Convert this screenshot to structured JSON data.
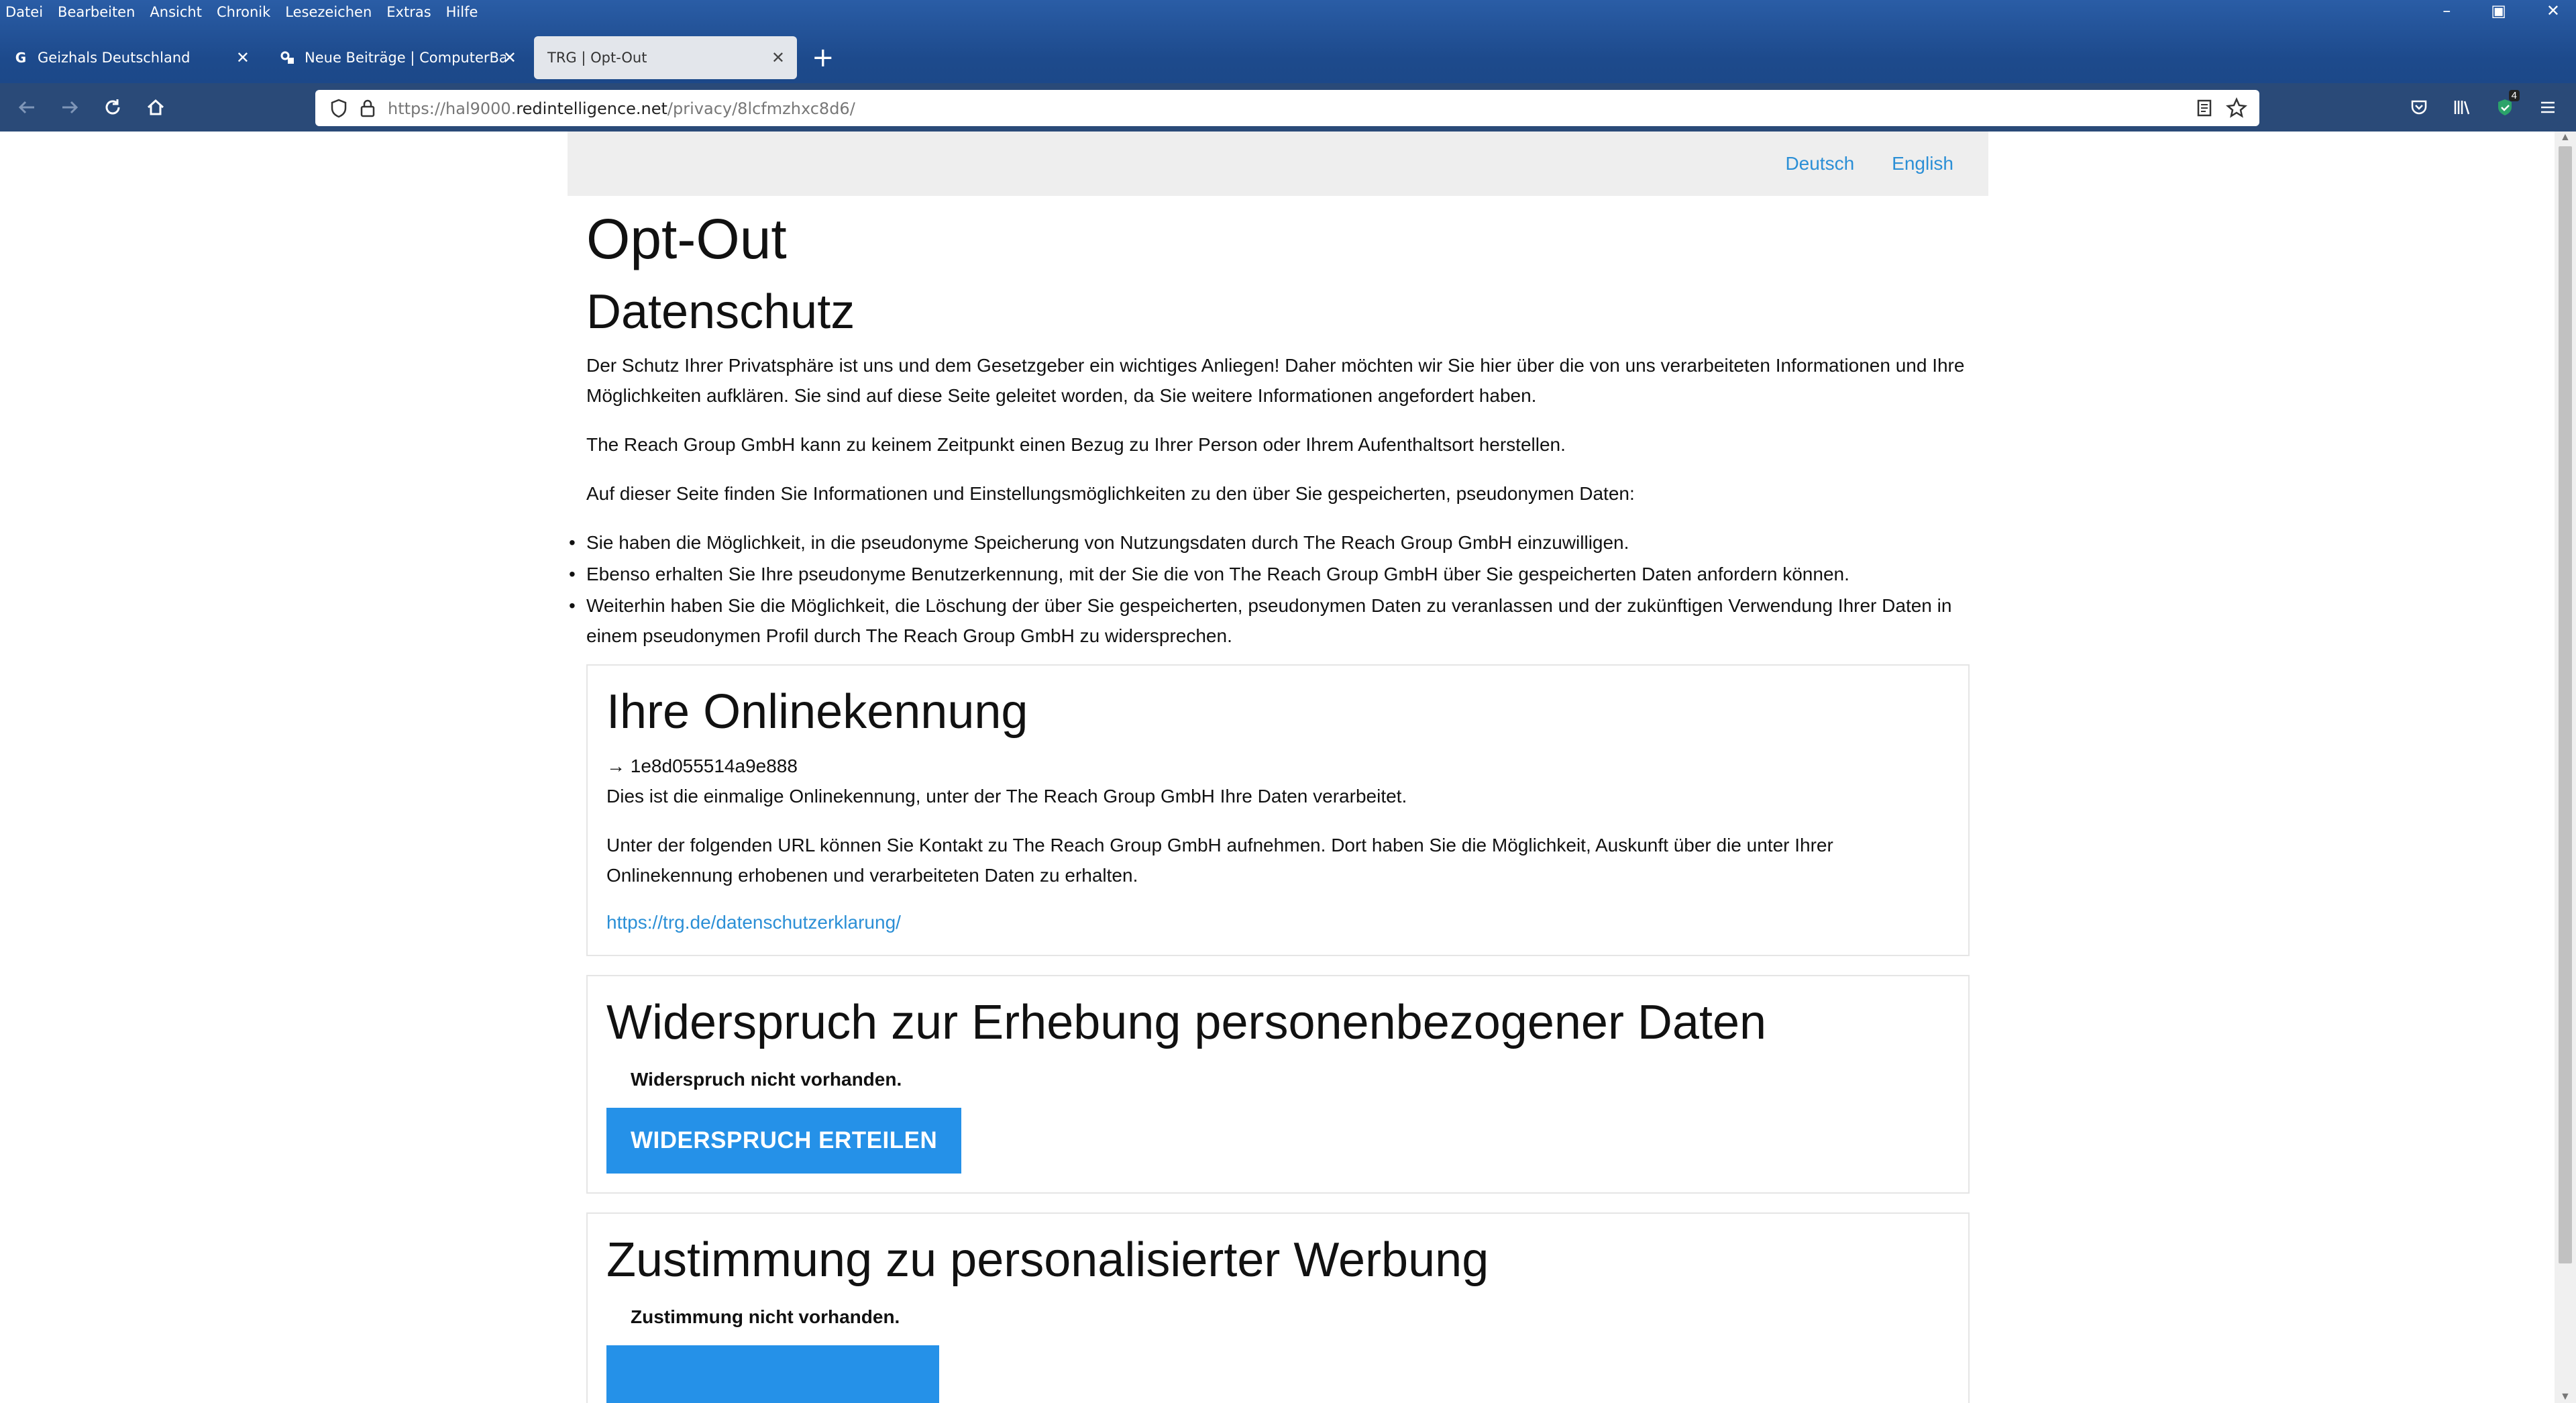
{
  "browser": {
    "menu": [
      "Datei",
      "Bearbeiten",
      "Ansicht",
      "Chronik",
      "Lesezeichen",
      "Extras",
      "Hilfe"
    ],
    "tabs": [
      {
        "title": "Geizhals Deutschland"
      },
      {
        "title": "Neue Beiträge | ComputerBase"
      },
      {
        "title": "TRG | Opt-Out"
      }
    ],
    "active_tab": 2,
    "url_prefix": "https://hal9000.",
    "url_domain": "redintelligence.net",
    "url_path": "/privacy/8lcfmzhxc8d6/",
    "extension_badge": "4",
    "accent": "#1d4a8c"
  },
  "lang": {
    "de": "Deutsch",
    "en": "English"
  },
  "page": {
    "title": "Opt-Out",
    "subtitle": "Datenschutz",
    "intro": "Der Schutz Ihrer Privatsphäre ist uns und dem Gesetzgeber ein wichtiges Anliegen! Daher möchten wir Sie hier über die von uns verarbeiteten Informationen und Ihre Möglichkeiten aufklären. Sie sind auf diese Seite geleitet worden, da Sie weitere Informationen angefordert haben.",
    "p2": "The Reach Group GmbH kann zu keinem Zeitpunkt einen Bezug zu Ihrer Person oder Ihrem Aufenthaltsort herstellen.",
    "p3": "Auf dieser Seite finden Sie Informationen und Einstellungsmöglichkeiten zu den über Sie gespeicherten, pseudonymen Daten:",
    "bullets": [
      "Sie haben die Möglichkeit, in die pseudonyme Speicherung von Nutzungsdaten durch The Reach Group GmbH einzuwilligen.",
      "Ebenso erhalten Sie Ihre pseudonyme Benutzerkennung, mit der Sie die von The Reach Group GmbH über Sie gespeicherten Daten anfordern können.",
      "Weiterhin haben Sie die Möglichkeit, die Löschung der über Sie gespeicherten, pseudonymen Daten zu veranlassen und der zukünftigen Verwendung Ihrer Daten in einem pseudonymen Profil durch The Reach Group GmbH zu widersprechen."
    ]
  },
  "online_id": {
    "heading": "Ihre Onlinekennung",
    "id": "→ 1e8d055514a9e888",
    "desc": "Dies ist die einmalige Onlinekennung, unter der The Reach Group GmbH Ihre Daten verarbeitet.",
    "contact": "Unter der folgenden URL können Sie Kontakt zu The Reach Group GmbH aufnehmen. Dort haben Sie die Möglichkeit, Auskunft über die unter Ihrer Onlinekennung erhobenen und verarbeiteten Daten zu erhalten.",
    "link": "https://trg.de/datenschutzerklarung/"
  },
  "objection": {
    "heading": "Widerspruch zur Erhebung personenbezogener Daten",
    "status": "Widerspruch nicht vorhanden.",
    "button": "WIDERSPRUCH ERTEILEN"
  },
  "consent": {
    "heading": "Zustimmung zu personalisierter Werbung",
    "status": "Zustimmung nicht vorhanden."
  },
  "colors": {
    "link": "#2b8fd6",
    "button": "#2591e8"
  }
}
